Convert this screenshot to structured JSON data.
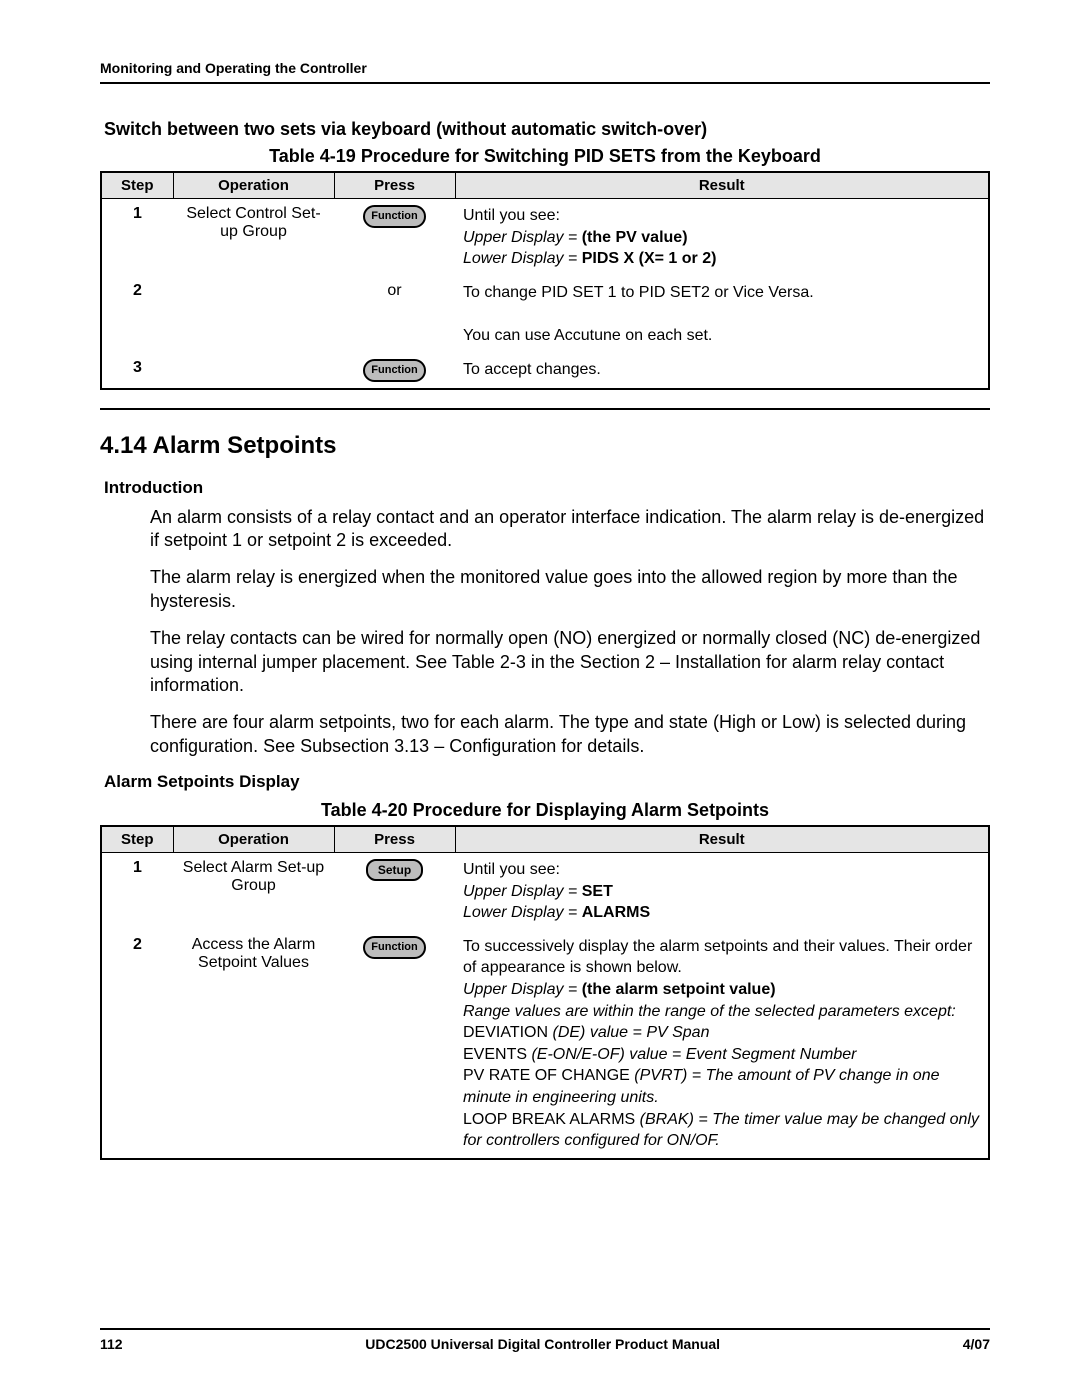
{
  "runningHead": "Monitoring and Operating the Controller",
  "headline1": "Switch between two sets via keyboard (without automatic switch-over)",
  "table19": {
    "caption": "Table 4-19  Procedure for Switching PID SETS from the Keyboard",
    "headers": {
      "step": "Step",
      "op": "Operation",
      "press": "Press",
      "result": "Result"
    },
    "rows": {
      "r1": {
        "step": "1",
        "op": "Select Control Set-up Group",
        "press": "Function",
        "result_pre": "Until you see:",
        "result_l1a": "Upper Display = ",
        "result_l1b": "(the PV value)",
        "result_l2a": "Lower Display = ",
        "result_l2b": "PIDS X",
        "result_l2c": "      (X= 1 or 2)"
      },
      "r2": {
        "step": "2",
        "press": "or",
        "result_a": "To change PID SET 1 to PID SET2 or Vice Versa.",
        "result_b": "You can use Accutune on each set."
      },
      "r3": {
        "step": "3",
        "press": "Function",
        "result": "To accept changes."
      }
    }
  },
  "sectionTitle": "4.14  Alarm Setpoints",
  "introHeading": "Introduction",
  "intro": {
    "p1": "An alarm consists of a relay contact and an operator interface indication. The alarm relay is de-energized if setpoint 1 or setpoint 2 is exceeded.",
    "p2": "The alarm relay is energized when the monitored value goes into the allowed region by more than the hysteresis.",
    "p3": "The relay contacts can be wired for normally open (NO) energized or normally closed (NC) de-energized using internal jumper placement. See Table 2-3 in the Section 2 – Installation for alarm relay contact information.",
    "p4": "There are four alarm setpoints, two for each alarm. The type and state (High or Low) is selected during configuration. See Subsection 3.13 – Configuration for details."
  },
  "displayHeading": "Alarm Setpoints Display",
  "table20": {
    "caption": "Table 4-20  Procedure for Displaying Alarm Setpoints",
    "headers": {
      "step": "Step",
      "op": "Operation",
      "press": "Press",
      "result": "Result"
    },
    "rows": {
      "r1": {
        "step": "1",
        "op": "Select Alarm Set-up Group",
        "press": "Setup",
        "result_pre": "Until you see:",
        "result_l1a": "Upper Display = ",
        "result_l1b": "SET",
        "result_l2a": "Lower Display = ",
        "result_l2b": "ALARMS"
      },
      "r2": {
        "step": "2",
        "op": "Access the Alarm Setpoint Values",
        "press": "Function",
        "res_a": "To successively display the alarm setpoints and their values. Their order of appearance is shown below.",
        "res_b1": "Upper Display = ",
        "res_b2": "(the alarm setpoint value)",
        "res_c": "Range values are within the range of the selected parameters except:",
        "res_d1": "DEVIATION ",
        "res_d2": "(DE) value = PV Span",
        "res_e1": "EVENTS ",
        "res_e2": "(E-ON/E-OF) value = Event Segment Number",
        "res_f1": "PV RATE OF CHANGE  ",
        "res_f2": "(PVRT) = The amount of PV change in one minute in engineering units.",
        "res_g1": "LOOP BREAK ALARMS   ",
        "res_g2": "(BRAK) = The timer value may be changed only for controllers configured for ON/OF."
      }
    }
  },
  "footer": {
    "pageNum": "112",
    "title": "UDC2500 Universal Digital Controller Product Manual",
    "date": "4/07"
  }
}
